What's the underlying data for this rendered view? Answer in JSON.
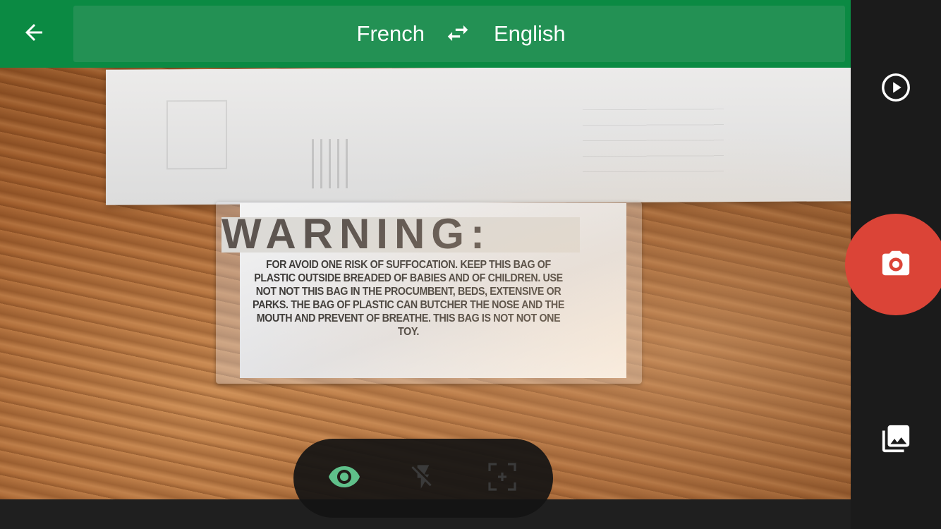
{
  "header": {
    "source_language": "French",
    "target_language": "English",
    "back_icon": "arrow-left-icon",
    "swap_icon": "swap-arrows-icon"
  },
  "scene": {
    "warning_title": "WARNING:",
    "warning_body": "FOR AVOID ONE RISK OF SUFFOCATION. KEEP THIS BAG OF PLASTIC OUTSIDE BREADED OF BABIES AND OF CHILDREN. USE NOT NOT THIS BAG IN THE PROCUMBENT, BEDS, EXTENSIVE OR PARKS. THE BAG OF PLASTIC CAN BUTCHER THE NOSE AND THE MOUTH AND PREVENT OF BREATHE. THIS BAG IS NOT NOT ONE TOY."
  },
  "toolbar": {
    "items": [
      {
        "icon": "eye-icon",
        "active": true
      },
      {
        "icon": "flash-off-icon",
        "active": false
      },
      {
        "icon": "focus-frame-icon",
        "active": false
      }
    ]
  },
  "rail": {
    "play_icon": "play-circle-icon",
    "shutter_icon": "camera-icon",
    "gallery_icon": "gallery-icon"
  },
  "colors": {
    "header_bg": "#0b8a43",
    "language_bar_bg": "#239154",
    "shutter": "#db4437",
    "eye_active": "#5fc08a",
    "rail_bg": "#1b1b1b"
  }
}
